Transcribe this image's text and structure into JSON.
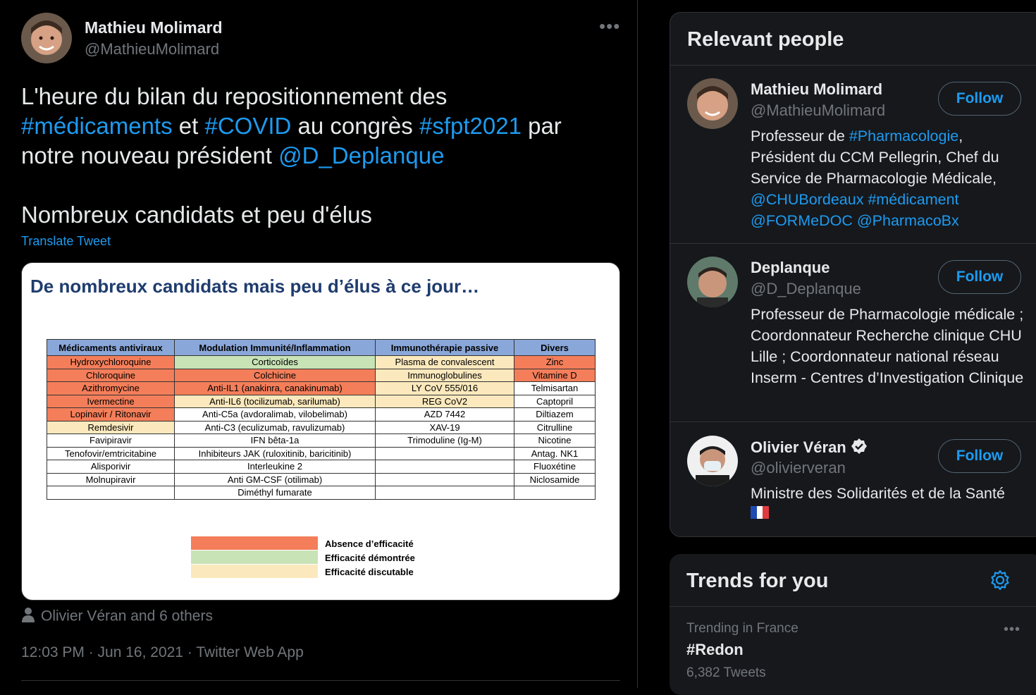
{
  "tweet": {
    "author_name": "Mathieu Molimard",
    "author_handle": "@MathieuMolimard",
    "more": "•••",
    "text_parts": [
      {
        "t": "L'heure du bilan du repositionnement des ",
        "link": false
      },
      {
        "t": "#médicaments",
        "link": true
      },
      {
        "t": " et ",
        "link": false
      },
      {
        "t": "#COVID",
        "link": true
      },
      {
        "t": " au congrès ",
        "link": false
      },
      {
        "t": "#sfpt2021",
        "link": true
      },
      {
        "t": " par notre nouveau président ",
        "link": false
      },
      {
        "t": "@D_Deplanque",
        "link": true
      }
    ],
    "text_second": "Nombreux candidats et peu d'élus",
    "translate": "Translate Tweet",
    "liked_by": "Olivier Véran and 6 others",
    "timestamp": "12:03 PM · Jun 16, 2021 · Twitter Web App"
  },
  "slide": {
    "title": "De nombreux candidats mais peu d’élus à ce jour…",
    "headers": [
      "Médicaments antiviraux",
      "Modulation Immunité/Inflammation",
      "Immunothérapie passive",
      "Divers"
    ],
    "rows": [
      [
        {
          "t": "Hydroxychloroquine",
          "c": "r"
        },
        {
          "t": "Corticoïdes",
          "c": "g"
        },
        {
          "t": "Plasma de convalescent",
          "c": "y"
        },
        {
          "t": "Zinc",
          "c": "r"
        }
      ],
      [
        {
          "t": "Chloroquine",
          "c": "r"
        },
        {
          "t": "Colchicine",
          "c": "r"
        },
        {
          "t": "Immunoglobulines",
          "c": "y"
        },
        {
          "t": "Vitamine D",
          "c": "r"
        }
      ],
      [
        {
          "t": "Azithromycine",
          "c": "r"
        },
        {
          "t": "Anti-IL1 (anakinra, canakinumab)",
          "c": "r"
        },
        {
          "t": "LY CoV 555/016",
          "c": "y"
        },
        {
          "t": "Telmisartan",
          "c": ""
        }
      ],
      [
        {
          "t": "Ivermectine",
          "c": "r"
        },
        {
          "t": "Anti-IL6 (tocilizumab, sarilumab)",
          "c": "y"
        },
        {
          "t": "REG CoV2",
          "c": "y"
        },
        {
          "t": "Captopril",
          "c": ""
        }
      ],
      [
        {
          "t": "Lopinavir / Ritonavir",
          "c": "r"
        },
        {
          "t": "Anti-C5a (avdoralimab, vilobelimab)",
          "c": ""
        },
        {
          "t": "AZD 7442",
          "c": ""
        },
        {
          "t": "Diltiazem",
          "c": ""
        }
      ],
      [
        {
          "t": "Remdesivir",
          "c": "y"
        },
        {
          "t": "Anti-C3 (eculizumab, ravulizumab)",
          "c": ""
        },
        {
          "t": "XAV-19",
          "c": ""
        },
        {
          "t": "Citrulline",
          "c": ""
        }
      ],
      [
        {
          "t": "Favipiravir",
          "c": ""
        },
        {
          "t": "IFN bêta-1a",
          "c": ""
        },
        {
          "t": "Trimoduline (Ig-M)",
          "c": ""
        },
        {
          "t": "Nicotine",
          "c": ""
        }
      ],
      [
        {
          "t": "Tenofovir/emtricitabine",
          "c": ""
        },
        {
          "t": "Inhibiteurs JAK (ruloxitinib, baricitinib)",
          "c": ""
        },
        {
          "t": "",
          "c": ""
        },
        {
          "t": "Antag. NK1",
          "c": ""
        }
      ],
      [
        {
          "t": "Alisporivir",
          "c": ""
        },
        {
          "t": "Interleukine 2",
          "c": ""
        },
        {
          "t": "",
          "c": ""
        },
        {
          "t": "Fluoxétine",
          "c": ""
        }
      ],
      [
        {
          "t": "Molnupiravir",
          "c": ""
        },
        {
          "t": "Anti GM-CSF (otilimab)",
          "c": ""
        },
        {
          "t": "",
          "c": ""
        },
        {
          "t": "Niclosamide",
          "c": ""
        }
      ],
      [
        {
          "t": "",
          "c": ""
        },
        {
          "t": "Diméthyl fumarate",
          "c": ""
        },
        {
          "t": "",
          "c": ""
        },
        {
          "t": "",
          "c": ""
        }
      ]
    ],
    "legend": {
      "red": "Absence d’efficacité",
      "green": "Efficacité démontrée",
      "yellow": "Efficacité discutable"
    },
    "colors": {
      "r": "#f47e5a",
      "g": "#c8e3b6",
      "y": "#fbe9bd"
    }
  },
  "relevant": {
    "title": "Relevant people",
    "follow_label": "Follow",
    "people": [
      {
        "name": "Mathieu Molimard",
        "handle": "@MathieuMolimard",
        "bio_parts": [
          {
            "t": "Professeur de ",
            "link": false
          },
          {
            "t": "#Pharmacologie",
            "link": true
          },
          {
            "t": ", Président du CCM Pellegrin, Chef du Service de Pharmacologie Médicale, ",
            "link": false
          },
          {
            "t": "@CHUBordeaux",
            "link": true
          },
          {
            "t": " ",
            "link": false
          },
          {
            "t": "#médicament",
            "link": true
          },
          {
            "t": " ",
            "link": false
          },
          {
            "t": "@FORMeDOC",
            "link": true
          },
          {
            "t": " ",
            "link": false
          },
          {
            "t": "@PharmacoBx",
            "link": true
          }
        ]
      },
      {
        "name": "Deplanque",
        "handle": "@D_Deplanque",
        "bio_parts": [
          {
            "t": "Professeur de Pharmacologie médicale ; Coordonnateur Recherche clinique CHU Lille ; Coordonnateur national réseau Inserm - Centres d’Investigation Clinique",
            "link": false
          }
        ]
      },
      {
        "name": "Olivier Véran",
        "handle": "@olivierveran",
        "bio_parts": [
          {
            "t": "Ministre des Solidarités et de la Santé",
            "link": false
          }
        ]
      }
    ]
  },
  "trends": {
    "title": "Trends for you",
    "items": [
      {
        "context": "Trending in France",
        "name": "#Redon",
        "count": "6,382 Tweets"
      }
    ]
  }
}
